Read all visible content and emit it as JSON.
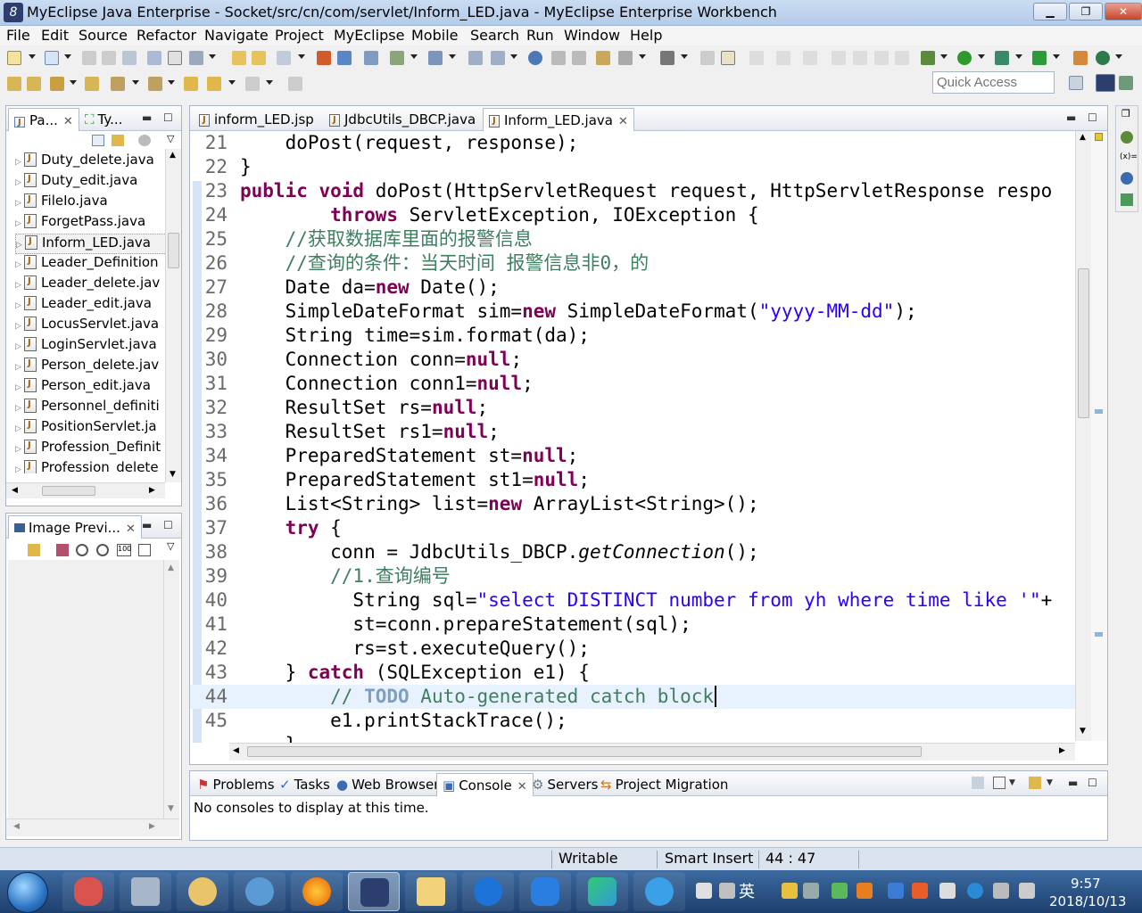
{
  "window": {
    "title": "MyEclipse Java Enterprise - Socket/src/cn/com/servlet/Inform_LED.java - MyEclipse Enterprise Workbench"
  },
  "menu": [
    "File",
    "Edit",
    "Source",
    "Refactor",
    "Navigate",
    "Project",
    "MyEclipse",
    "Mobile",
    "Search",
    "Run",
    "Window",
    "Help"
  ],
  "quick_access": {
    "placeholder": "Quick Access"
  },
  "explorer": {
    "tab_package": "Pa...",
    "tab_type": "Ty...",
    "files": [
      "Duty_delete.java",
      "Duty_edit.java",
      "FileIo.java",
      "ForgetPass.java",
      "Inform_LED.java",
      "Leader_Definition",
      "Leader_delete.jav",
      "Leader_edit.java",
      "LocusServlet.java",
      "LoginServlet.java",
      "Person_delete.jav",
      "Person_edit.java",
      "Personnel_definiti",
      "PositionServlet.ja",
      "Profession_Definit",
      "Profession_delete"
    ]
  },
  "image_preview": {
    "tab": "Image Previ..."
  },
  "editor": {
    "tabs": [
      {
        "label": "inform_LED.jsp"
      },
      {
        "label": "JdbcUtils_DBCP.java"
      },
      {
        "label": "Inform_LED.java"
      }
    ],
    "line_numbers": [
      "21",
      "22",
      "23",
      "24",
      "25",
      "26",
      "27",
      "28",
      "29",
      "30",
      "31",
      "32",
      "33",
      "34",
      "35",
      "36",
      "37",
      "38",
      "39",
      "40",
      "41",
      "42",
      "43",
      "44",
      "45"
    ]
  },
  "bottom_panel": {
    "tabs": [
      "Problems",
      "Tasks",
      "Web Browser",
      "Console",
      "Servers",
      "Project Migration"
    ],
    "message": "No consoles to display at this time."
  },
  "status": {
    "mode": "Writable",
    "insert": "Smart Insert",
    "position": "44 : 47"
  },
  "taskbar": {
    "time": "9:57",
    "date": "2018/10/13",
    "ime": "英"
  },
  "colors": {
    "keyword": "#7f0055",
    "string": "#2a00ff",
    "comment": "#3f7f5f",
    "current_line": "#e8f2fe"
  }
}
